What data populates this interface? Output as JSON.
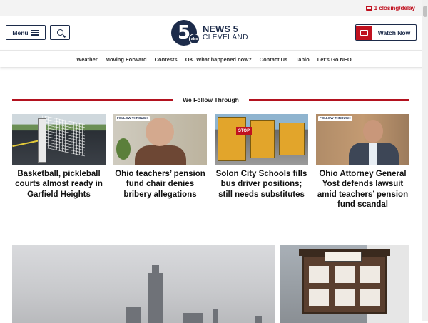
{
  "alert": {
    "text": "1 closing/delay"
  },
  "header": {
    "menu_label": "Menu",
    "logo_numeral": "5",
    "logo_abc": "abc",
    "logo_news": "NEWS 5",
    "logo_city": "CLEVELAND",
    "watch_label": "Watch Now"
  },
  "subnav": {
    "items": [
      "Weather",
      "Moving Forward",
      "Contests",
      "OK. What happened now?",
      "Contact Us",
      "Tablo",
      "Let's Go NEO"
    ]
  },
  "section": {
    "title": "We Follow Through"
  },
  "cards": [
    {
      "title": "Basketball, pickleball courts almost ready in Garfield Heights",
      "badge": ""
    },
    {
      "title": "Ohio teachers’ pension fund chair denies bribery allegations",
      "badge": "FOLLOW THROUGH"
    },
    {
      "title": "Solon City Schools fills bus driver positions; still needs substitutes",
      "badge": ""
    },
    {
      "title": "Ohio Attorney General Yost defends lawsuit amid teachers’ pension fund scandal",
      "badge": "FOLLOW THROUGH"
    }
  ],
  "thumb_text": {
    "stop_sign": "STOP"
  },
  "colors": {
    "brand_navy": "#1c2b4a",
    "accent_red": "#c0111f",
    "section_rule": "#b3121f"
  }
}
